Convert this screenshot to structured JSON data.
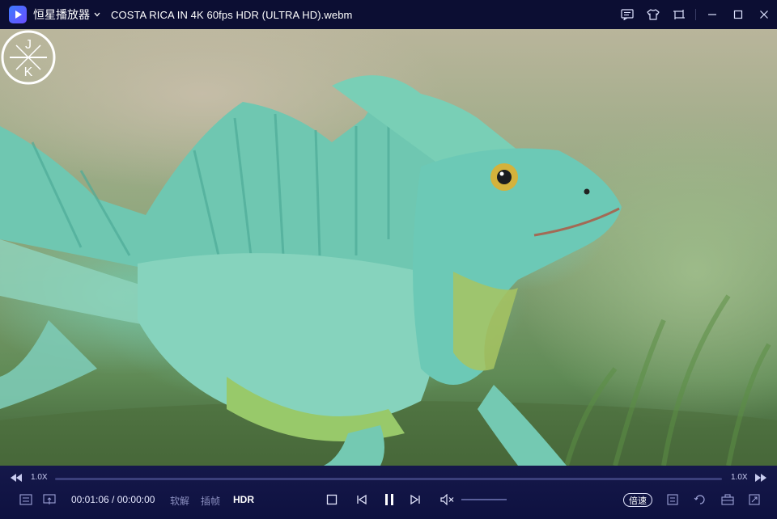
{
  "app": {
    "name": "恒星播放器",
    "file_title": "COSTA RICA IN 4K 60fps HDR (ULTRA HD).webm"
  },
  "watermark": {
    "letters": [
      "J",
      "K"
    ]
  },
  "seekbar": {
    "speed_left": "1.0X",
    "speed_right": "1.0X",
    "progress": 0.0
  },
  "controls": {
    "time": "00:01:06 / 00:00:00",
    "soft_decode": "软解",
    "frame_interp": "插帧",
    "hdr": "HDR",
    "speed_label": "倍速",
    "volume_level": 0.0
  },
  "colors": {
    "titlebar": "#0c0e33",
    "controls": "#15184a",
    "accent": "#6f79d8"
  }
}
